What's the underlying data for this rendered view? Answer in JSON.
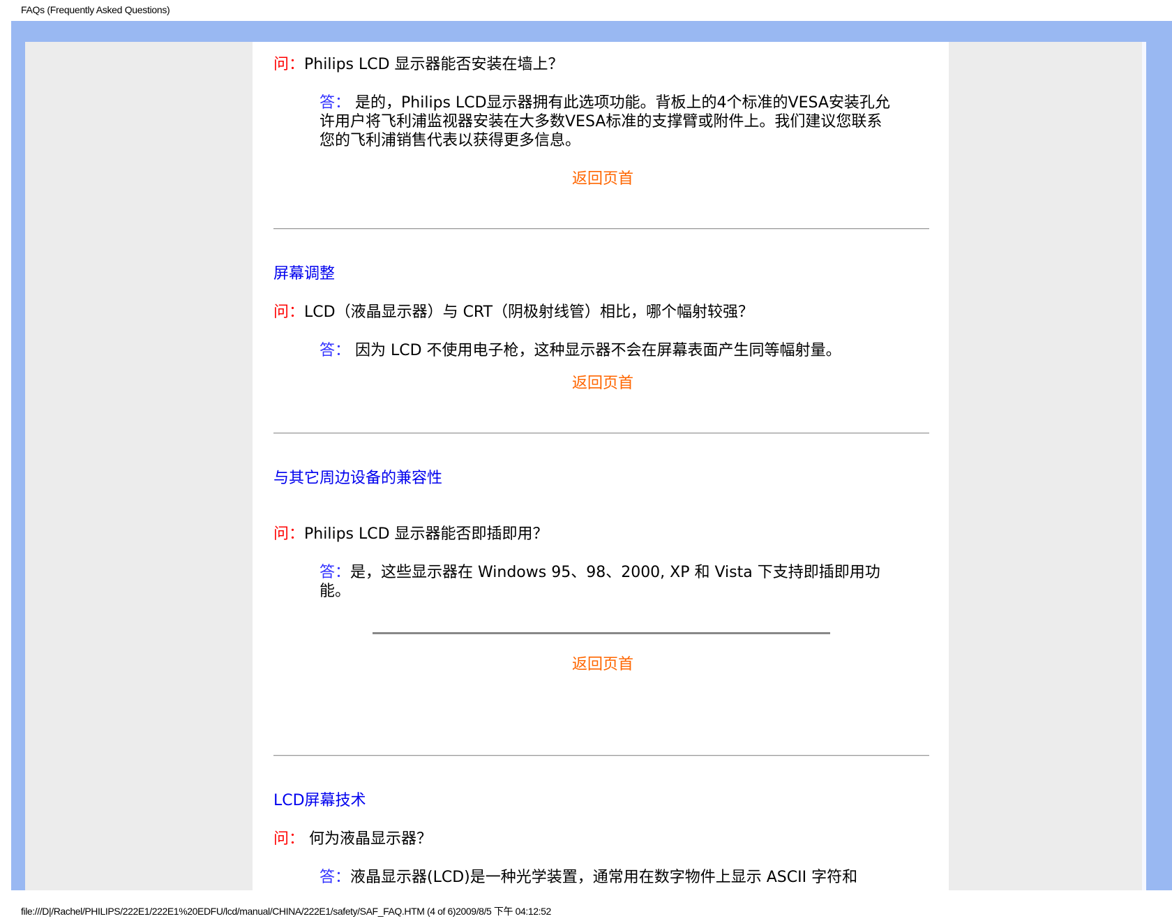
{
  "header": {
    "title": "FAQs (Frequently Asked Questions)"
  },
  "footer": {
    "path": "file:///D|/Rachel/PHILIPS/222E1/222E1%20EDFU/lcd/manual/CHINA/222E1/safety/SAF_FAQ.HTM (4 of 6)2009/8/5 下午 04:12:52"
  },
  "faq": {
    "q_mark": "问：",
    "a_mark": "答：",
    "back_label": "返回页首",
    "items": [
      {
        "question": "Philips LCD 显示器能否安装在墙上？",
        "answer": "是的，Philips LCD显示器拥有此选项功能。背板上的4个标准的VESA安装孔允许用户将飞利浦监视器安装在大多数VESA标准的支撑臂或附件上。我们建议您联系您的飞利浦销售代表以获得更多信息。"
      },
      {
        "section": "屏幕调整",
        "question": "LCD（液晶显示器）与 CRT（阴极射线管）相比，哪个幅射较强？",
        "answer": "因为 LCD 不使用电子枪，这种显示器不会在屏幕表面产生同等幅射量。"
      },
      {
        "section": "与其它周边设备的兼容性",
        "question": "Philips LCD 显示器能否即插即用？",
        "answer": "是，这些显示器在 Windows 95、98、2000, XP 和 Vista 下支持即插即用功能。"
      },
      {
        "section": "LCD屏幕技术",
        "question": "何为液晶显示器？",
        "answer": "液晶显示器(LCD)是一种光学装置，通常用在数字物件上显示 ASCII 字符和"
      }
    ]
  }
}
